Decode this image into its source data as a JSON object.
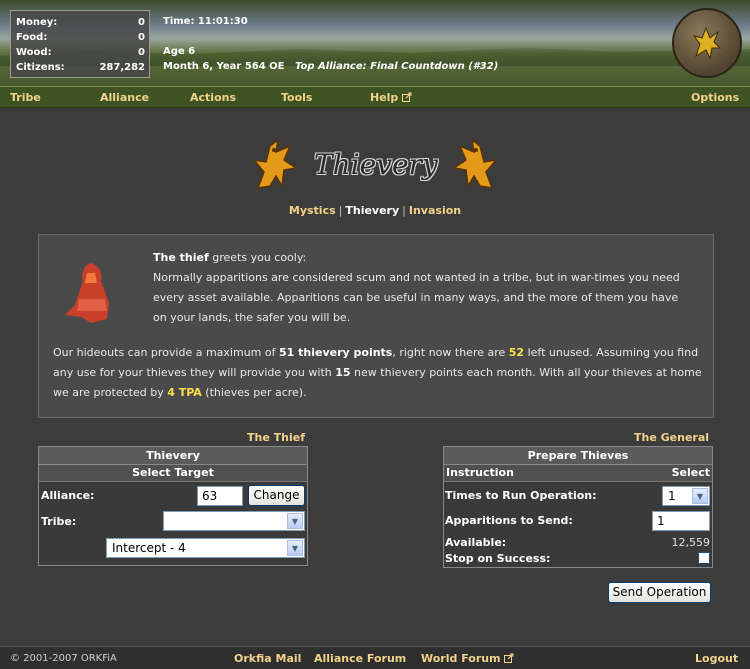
{
  "header": {
    "stats": [
      {
        "label": "Money:",
        "value": "0"
      },
      {
        "label": "Food:",
        "value": "0"
      },
      {
        "label": "Wood:",
        "value": "0"
      },
      {
        "label": "Citizens:",
        "value": "287,282"
      }
    ],
    "time": "Time: 11:01:30",
    "age": "Age 6",
    "date": "Month 6, Year 564 OE",
    "top_alliance": "Top Alliance: Final Countdown (#32)"
  },
  "nav": {
    "tribe": "Tribe",
    "alliance": "Alliance",
    "actions": "Actions",
    "tools": "Tools",
    "help": "Help",
    "options": "Options"
  },
  "section": {
    "title": "Thievery",
    "subnav": {
      "mystics": "Mystics",
      "thievery": "Thievery",
      "invasion": "Invasion",
      "sep": "|"
    }
  },
  "info": {
    "greeting_name": "The thief",
    "greeting_rest": "greets you cooly:",
    "intro": "Normally apparitions are considered scum and not wanted in a tribe, but in war-times you need every asset available. Apparitions can be useful in many ways, and the more of them you have on your lands, the safer you will be.",
    "p1": "Our hideouts can provide a maximum of",
    "max_points": "51 thievery points",
    "p2": ", right now there are",
    "left_points": "52",
    "p3": "left unused. Assuming you find any use for your thieves they will provide you with",
    "new_points": "15",
    "p4": "new thievery points each month. With all your thieves at home we are protected by",
    "tpa": "4 TPA",
    "p5": "(thieves per acre)."
  },
  "left_form": {
    "column_title": "The Thief",
    "head": "Thievery",
    "subhead": "Select Target",
    "alliance_label": "Alliance:",
    "alliance_value": "63",
    "change_button": "Change",
    "tribe_label": "Tribe:",
    "tribe_value": "",
    "operation_value": "Intercept - 4"
  },
  "right_form": {
    "column_title": "The General",
    "head": "Prepare Thieves",
    "col_instruction": "Instruction",
    "col_select": "Select",
    "times_label": "Times to Run Operation:",
    "times_value": "1",
    "apparitions_label": "Apparitions to Send:",
    "apparitions_value": "1",
    "available_label": "Available:",
    "available_value": "12,559",
    "stop_label": "Stop on Success:",
    "send_button": "Send Operation"
  },
  "footer": {
    "copyright": "© 2001-2007 ORKFiA",
    "mail": "Orkfia Mail",
    "alliance_forum": "Alliance Forum",
    "world_forum": "World Forum",
    "logout": "Logout"
  },
  "colors": {
    "nav_bg": "#3f5221",
    "link": "#f2d38a",
    "highlight": "#f7e04a",
    "panel_bg": "#4a4a4a"
  },
  "icons": [
    "griffin-icon",
    "external-link-icon",
    "thief-portrait",
    "chevron-down-icon",
    "emblem-icon"
  ]
}
